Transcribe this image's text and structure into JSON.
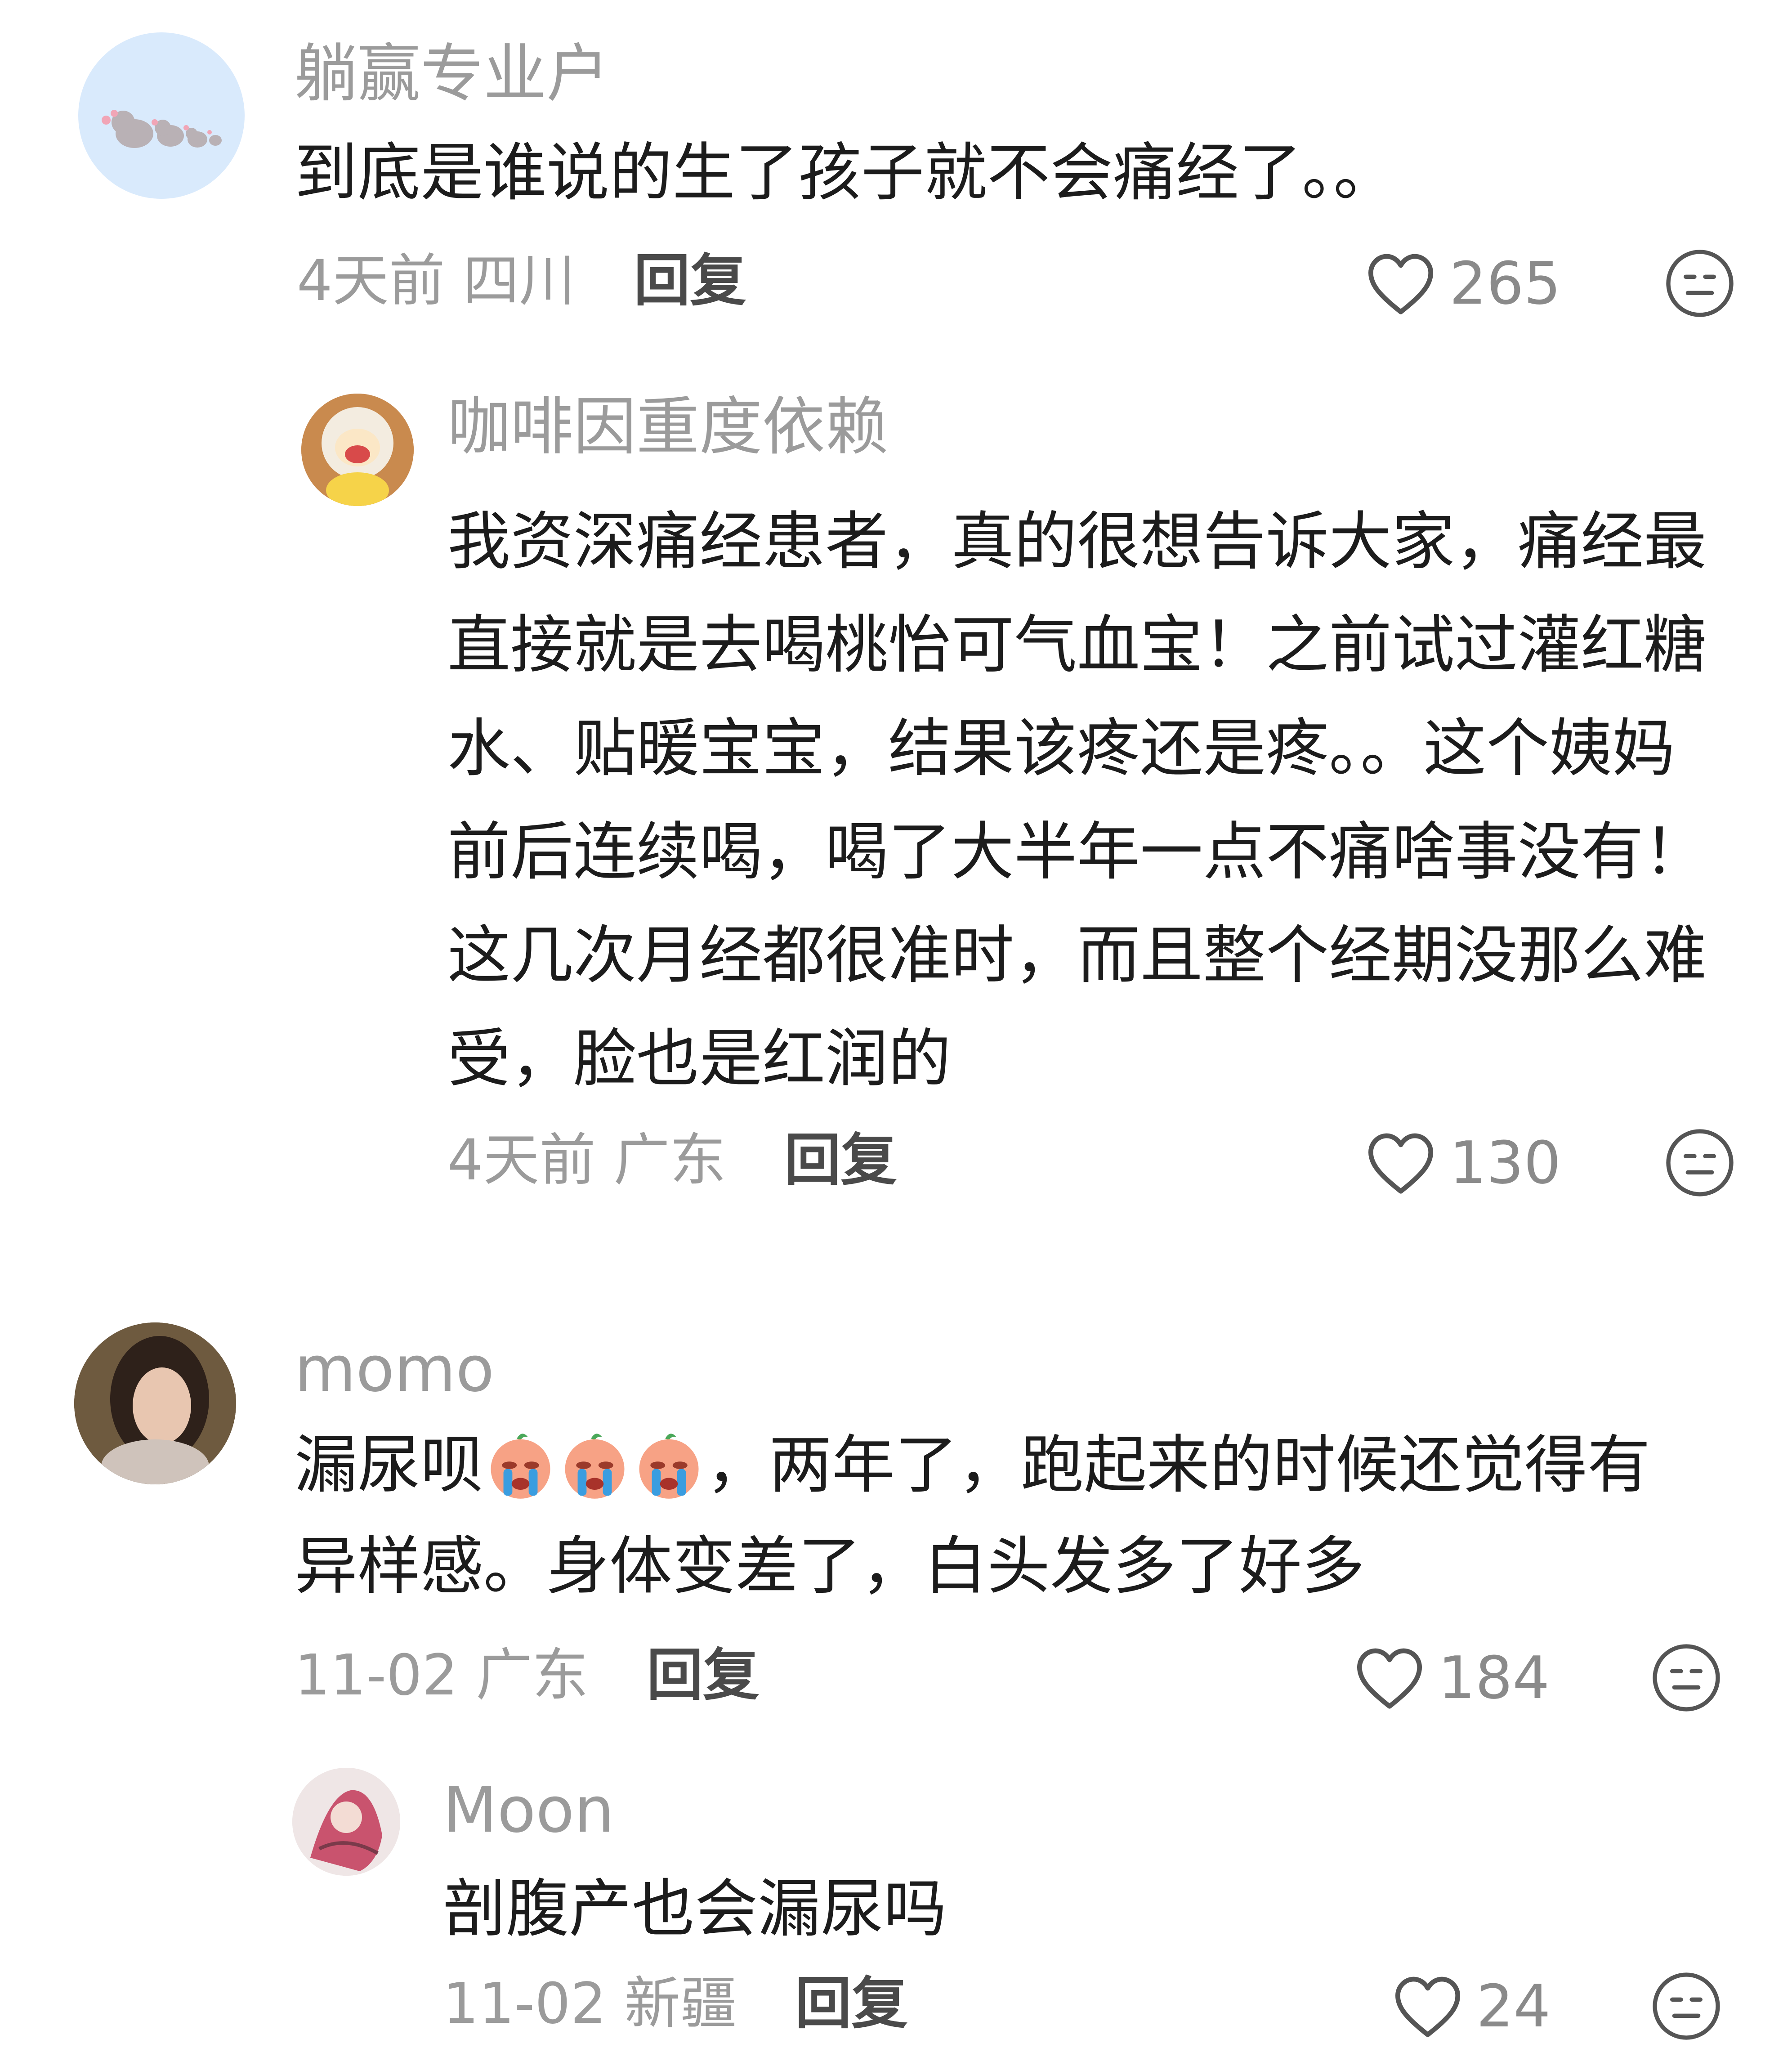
{
  "comments": [
    {
      "username": "躺赢专业户",
      "text": "到底是谁说的生了孩子就不会痛经了。。",
      "time": "4天前",
      "location": "四川",
      "reply_label": "回复",
      "likes": "265",
      "avatar_icon": "elephant-avatar-icon",
      "replies": [
        {
          "username": "咖啡因重度依赖",
          "text_lines": [
            "我资深痛经患者，真的很想告诉大家，痛经最",
            "直接就是去喝桃怡可气血宝！之前试过灌红糖",
            "水、贴暖宝宝，结果该疼还是疼。。这个姨妈",
            "前后连续喝，喝了大半年一点不痛啥事没有！",
            "这几次月经都很准时，而且整个经期没那么难",
            "受，脸也是红润的"
          ],
          "time": "4天前",
          "location": "广东",
          "reply_label": "回复",
          "likes": "130",
          "avatar_icon": "crying-cartoon-avatar-icon"
        }
      ]
    },
    {
      "username": "momo",
      "text_before_emoji": "漏尿呗",
      "emoji_icon": "crying-face-emoji-icon",
      "emoji_count": 3,
      "text_after_emoji": "，两年了，跑起来的时候还觉得有",
      "text_line2": "异样感。身体变差了，白头发多了好多",
      "time": "11-02",
      "location": "广东",
      "reply_label": "回复",
      "likes": "184",
      "avatar_icon": "woman-photo-avatar-icon",
      "replies": [
        {
          "username": "Moon",
          "text": "剖腹产也会漏尿吗",
          "time": "11-02",
          "location": "新疆",
          "reply_label": "回复",
          "likes": "24",
          "avatar_icon": "illustration-avatar-icon"
        }
      ]
    }
  ],
  "colors": {
    "meta_gray": "#9b9b9b",
    "text_dark": "#1c1c1c",
    "icon_gray": "#555555"
  }
}
